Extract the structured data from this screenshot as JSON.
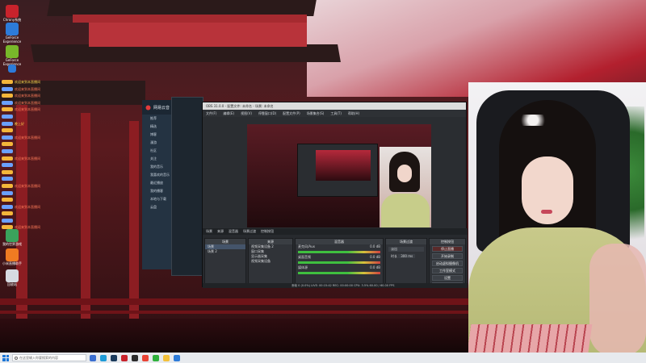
{
  "desktop": {
    "icons": [
      {
        "label": "Chrony系统",
        "color": "#c8232c"
      },
      {
        "label": "GeForce Experience",
        "color": "#2d7bd9"
      },
      {
        "label": "GeForce Experience",
        "color": "#78b82a"
      },
      {
        "label": "",
        "color": "#2d7bd9"
      }
    ],
    "bottom_icons": [
      {
        "label": "我的世界游戏",
        "color": "#3aa35c"
      },
      {
        "label": "小米直播助手",
        "color": "#f07b22"
      },
      {
        "label": "回收站",
        "color": "#d6dbe2"
      }
    ]
  },
  "chat": {
    "lines": [
      {
        "text": "欢迎来到本直播间",
        "color": "#ffd84d",
        "badge": "#f4b63a"
      },
      {
        "text": "欢迎来到本直播间",
        "color": "#ff7a59",
        "badge": "#6aa0ff"
      },
      {
        "text": "欢迎来到本直播间",
        "color": "#ff7a59",
        "badge": "#f4b63a"
      },
      {
        "text": "欢迎来到本直播间",
        "color": "#ff7a59",
        "badge": "#6aa0ff"
      },
      {
        "text": "欢迎来到本直播间",
        "color": "#ff7a59",
        "badge": "#f4b63a"
      },
      {
        "text": "",
        "color": "#ff7a59",
        "badge": "#6aa0ff"
      },
      {
        "text": "晚上好",
        "color": "#ffd84d",
        "badge": "#6aa0ff"
      },
      {
        "text": "",
        "color": "#ff7a59",
        "badge": "#f4b63a"
      },
      {
        "text": "欢迎来到本直播间",
        "color": "#ff7a59",
        "badge": "#6aa0ff"
      },
      {
        "text": "",
        "color": "#ffd84d",
        "badge": "#f4b63a"
      },
      {
        "text": "",
        "color": "#ff7a59",
        "badge": "#6aa0ff"
      },
      {
        "text": "欢迎来到本直播间",
        "color": "#ff7a59",
        "badge": "#f4b63a"
      },
      {
        "text": "",
        "color": "#ffd84d",
        "badge": "#6aa0ff"
      },
      {
        "text": "",
        "color": "#ff7a59",
        "badge": "#f4b63a"
      },
      {
        "text": "",
        "color": "#ff7a59",
        "badge": "#6aa0ff"
      },
      {
        "text": "欢迎来到本直播间",
        "color": "#ff7a59",
        "badge": "#f4b63a"
      },
      {
        "text": "",
        "color": "#ffd84d",
        "badge": "#6aa0ff"
      },
      {
        "text": "",
        "color": "#ff7a59",
        "badge": "#f4b63a"
      },
      {
        "text": "欢迎来到本直播间",
        "color": "#ff7a59",
        "badge": "#6aa0ff"
      },
      {
        "text": "",
        "color": "#ffd84d",
        "badge": "#f4b63a"
      },
      {
        "text": "",
        "color": "#ff7a59",
        "badge": "#6aa0ff"
      },
      {
        "text": "欢迎来到本直播间",
        "color": "#ff7a59",
        "badge": "#f4b63a"
      }
    ]
  },
  "music_app": {
    "title": "网易云音",
    "items": [
      "推荐",
      "精选",
      "博客",
      "漫游",
      "社区",
      "关注",
      "我的音乐",
      "我喜欢的音乐",
      "最近播放",
      "我的播客",
      "本地与下载",
      "云盘"
    ]
  },
  "obs": {
    "title": "OBS 31.0.0 - 配置文件: 未命名 - 场景: 未命名",
    "menu": [
      "文件(F)",
      "编辑(E)",
      "视图(V)",
      "停靠窗口(D)",
      "配置文件(P)",
      "场景集合(S)",
      "工具(T)",
      "帮助(H)"
    ],
    "dock_tabs": [
      "场景",
      "来源",
      "混音器",
      "场景过渡",
      "控制按钮"
    ],
    "scenes": [
      "场景",
      "场景 2"
    ],
    "sources": [
      "视频采集设备 2",
      "窗口采集",
      "显示器采集",
      "视频采集设备"
    ],
    "mixer": [
      {
        "name": "麦克风/Aux",
        "db": "0.0 dB"
      },
      {
        "name": "桌面音频",
        "db": "0.0 dB"
      },
      {
        "name": "媒体源",
        "db": "0.0 dB"
      }
    ],
    "transition": {
      "type": "淡出",
      "duration_label": "时长",
      "duration": "300 ms"
    },
    "controls": [
      "停止直播",
      "开始录制",
      "启动虚拟摄像机",
      "工作室模式",
      "设置",
      "退出"
    ],
    "status": "丢帧 0 (0.0%)   LIVE: 00:15:42   REC: 00:00:00   CPU: 3.5%   60.00 / 60.00 FPS"
  },
  "taskbar": {
    "search_placeholder": "在这里输入你要搜索的内容",
    "apps": [
      {
        "name": "task-view",
        "color": "#3b6fd1"
      },
      {
        "name": "edge",
        "color": "#1e9bd7"
      },
      {
        "name": "steam",
        "color": "#1a3a5c"
      },
      {
        "name": "netease-music",
        "color": "#c8232c"
      },
      {
        "name": "obs",
        "color": "#2b2b2b"
      },
      {
        "name": "chrome",
        "color": "#e84335"
      },
      {
        "name": "wechat",
        "color": "#2fb13c"
      },
      {
        "name": "files",
        "color": "#f3c03a"
      },
      {
        "name": "store",
        "color": "#2d7bd9"
      }
    ]
  }
}
